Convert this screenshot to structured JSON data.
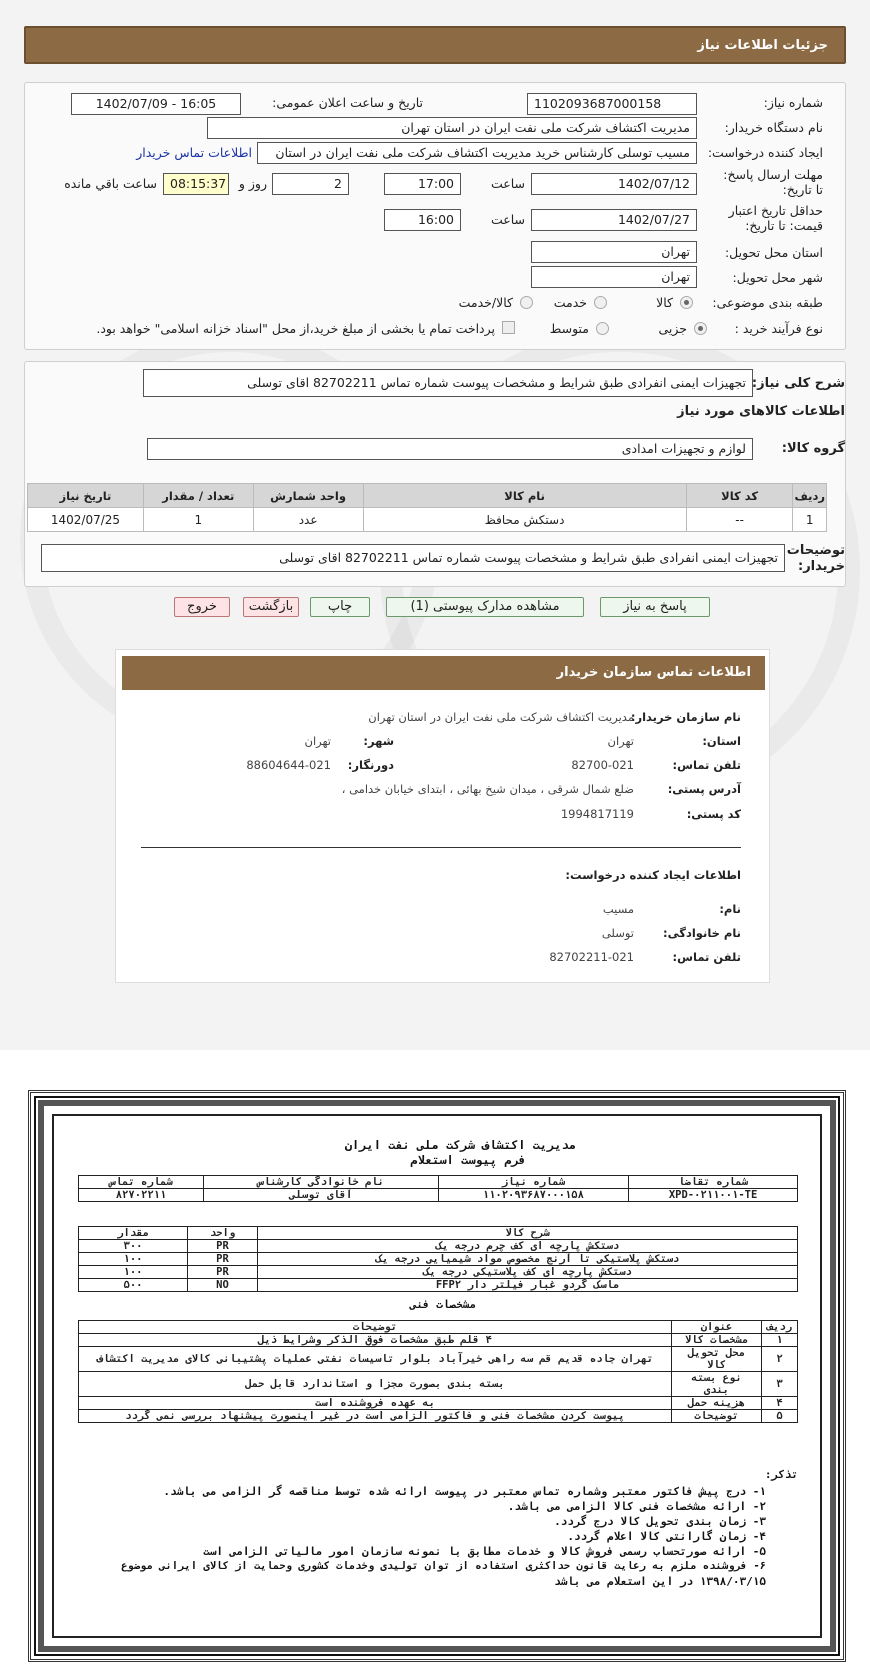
{
  "header": {
    "title": "جزئیات اطلاعات نیاز"
  },
  "form": {
    "need_number_label": "شماره نیاز:",
    "need_number": "1102093687000158",
    "announce_label": "تاریخ و ساعت اعلان عمومی:",
    "announce_value": "1402/07/09 - 16:05",
    "buyer_org_label": "نام دستگاه خریدار:",
    "buyer_org": "مدیریت اکتشاف شرکت ملی نفت ایران در استان تهران",
    "creator_label": "ایجاد کننده درخواست:",
    "creator": "مسیب توسلی کارشناس خرید مدیریت اکتشاف شرکت ملی نفت ایران در استان",
    "contact_link": "اطلاعات تماس خریدار",
    "deadline_label": "مهلت ارسال پاسخ: تا تاریخ:",
    "deadline_date": "1402/07/12",
    "time_label": "ساعت",
    "deadline_time": "17:00",
    "days": "2",
    "days_label": "روز و",
    "remaining": "08:15:37",
    "remaining_label": "ساعت باقي مانده",
    "validity_label": "حداقل تاریخ اعتبار قیمت: تا تاریخ:",
    "validity_date": "1402/07/27",
    "validity_time": "16:00",
    "province_label": "استان محل تحویل:",
    "province": "تهران",
    "city_label": "شهر محل تحویل:",
    "city": "تهران",
    "category_label": "طبقه بندی موضوعی:",
    "category_options": [
      "کالا",
      "خدمت",
      "کالا/خدمت"
    ],
    "process_label": "نوع فرآیند خرید :",
    "process_options": [
      "جزیی",
      "متوسط"
    ],
    "payment_note": "پرداخت تمام یا بخشی از مبلغ خرید،از محل \"اسناد خزانه اسلامی\" خواهد بود."
  },
  "summary": {
    "label": "شرح کلی نیاز:",
    "text": "تجهیزات ایمنی انفرادی  طبق شرایط و مشخصات پیوست  شماره تماس 82702211 اقای توسلی",
    "goods_info_title": "اطلاعات کالاهای مورد نیاز",
    "group_label": "گروه کالا:",
    "group_value": "لوازم و تجهیزات امدادی"
  },
  "table": {
    "headers": [
      "ردیف",
      "کد کالا",
      "نام کالا",
      "واحد شمارش",
      "تعداد / مقدار",
      "تاریخ نیاز"
    ],
    "rows": [
      [
        "1",
        "--",
        "دستکش محافظ",
        "عدد",
        "1",
        "1402/07/25"
      ]
    ]
  },
  "buyer_notes": {
    "label": "توضیحات خریدار:",
    "text": "تجهیزات ایمنی انفرادی  طبق شرایط و مشخصات پیوست  شماره تماس 82702211 اقای توسلی"
  },
  "buttons": {
    "reply": "پاسخ به نیاز",
    "docs": "مشاهده مدارک پیوستی (1)",
    "print": "چاپ",
    "back": "بازگشت",
    "exit": "خروج"
  },
  "contact": {
    "title": "اطلاعات تماس سازمان خریدار",
    "org_label": "نام سازمان خریدار:",
    "org": "مدیریت اکتشاف شرکت ملی نفت ایران در استان تهران",
    "province_label": "استان:",
    "province": "تهران",
    "city_label": "شهر:",
    "city": "تهران",
    "phone_label": "تلفن تماس:",
    "phone": "82700-021",
    "fax_label": "دورنگار:",
    "fax": "88604644-021",
    "address_label": "آدرس پستی:",
    "address": "ضلع شمال شرقی ، میدان شیخ بهائی ، ابتدای خیابان خدامی ،",
    "postal_label": "کد پستی:",
    "postal": "1994817119",
    "requester_title": "اطلاعات ایجاد کننده درخواست:",
    "name_label": "نام:",
    "name": "مسیب",
    "family_label": "نام خانوادگی:",
    "family": "توسلی",
    "req_phone_label": "تلفن تماس:",
    "req_phone": "82702211-021"
  },
  "scan": {
    "company": "مدیریت اکتشاف شرکت ملی نفت ایران",
    "form_title": "فرم پیوست استعلام",
    "head_cols": [
      "شماره تقاضا",
      "شماره نیاز",
      "نام خانوادگی کارشناس",
      "شماره تماس"
    ],
    "head_vals": [
      "XPD-۰۲۱۱۰۰۱-TE",
      "۱۱۰۲۰۹۳۶۸۷۰۰۰۱۵۸",
      "آقای توسلی",
      "۸۲۷۰۲۲۱۱"
    ],
    "goods_cols": [
      "شرح کالا",
      "واحد",
      "مقدار"
    ],
    "goods": [
      [
        "دستکش پارچه ای کف چرم درجه یک",
        "PR",
        "۳۰۰"
      ],
      [
        "دستکش پلاستیکی تا آرنج مخصوص مواد شیمیایی درجه یک",
        "PR",
        "۱۰۰"
      ],
      [
        "دستکش پارچه ای کف پلاستیکی درجه یک",
        "PR",
        "۱۰۰"
      ],
      [
        "ماسک گردو غبار فیلتر دار FFP۲",
        "NO",
        "۵۰۰"
      ]
    ],
    "spec_title": "مشخصات فنی",
    "spec_cols": [
      "ردیف",
      "عنوان",
      "توضیحات"
    ],
    "specs": [
      [
        "۱",
        "مشخصات کالا",
        "۴ قلم  طبق مشخصات فوق الذکر وشرایط ذیل"
      ],
      [
        "۲",
        "محل تحویل کالا",
        "تهران جاده قدیم قم سه راهی خیرآباد بلوار تاسیسات نفتی  عملیات پشتیبانی کالای مدیریت اکتشاف"
      ],
      [
        "۳",
        "نوع بسته بندی",
        "بسته بندی بصورت مجزا و استاندارد قابل حمل"
      ],
      [
        "۴",
        "هزینه حمل",
        "به عهده فروشنده است"
      ],
      [
        "۵",
        "توضیحات",
        "پیوست کردن مشخصات فنی  و فاکتور الزامی است در غیر اینصورت پیشنهاد  بررسی نمی گردد"
      ]
    ],
    "notes_title": "تذکر:",
    "notes": [
      "۱- درج پیش فاکتور معتبر وشماره تماس معتبر در پیوست ارائه شده توسط مناقصه گر الزامی می باشد.",
      "۲- ارائه مشخصات فنی کالا الزامی می باشد.",
      "۳- زمان بندی تحویل کالا درج گردد.",
      "۴- زمان گارانتی کالا اعلام گردد.",
      "۵- ارائه صورتحساب رسمی فروش کالا و خدمات مطابق با نمونه سازمان امور مالیاتی الزامی است",
      "۶- فروشنده ملزم به رعایت قانون حداکثری استفاده از توان تولیدی وخدمات کشوری وحمایت از کالای ایرانی موضوع",
      "۱۳۹۸/۰۳/۱۵ در این استعلام می باشد"
    ]
  }
}
